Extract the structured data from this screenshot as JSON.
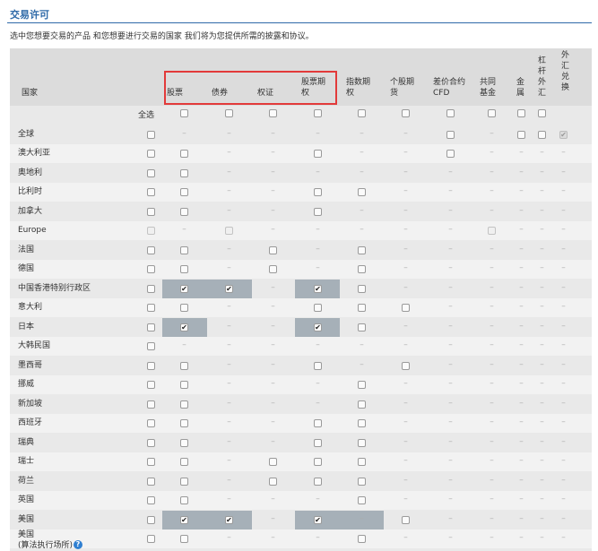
{
  "title": "交易许可",
  "description": "选中您想要交易的产品 和您想要进行交易的国家 我们将为您提供所需的披露和协议。",
  "header": {
    "country": "国家",
    "stocks": "股票",
    "bonds": "债券",
    "warrants": "权证",
    "stock_options": [
      "股票期",
      "权"
    ],
    "index_options": [
      "指数期",
      "权"
    ],
    "stock_futures": [
      "个股期",
      "货"
    ],
    "cfd": [
      "差价合约",
      "CFD"
    ],
    "mutual_funds": [
      "共同",
      "基金"
    ],
    "metals": [
      "金",
      "属"
    ],
    "leveraged_fx": "杠杆外汇",
    "fx_conversion": "外汇兑换"
  },
  "select_all_label": "全选",
  "rows": [
    {
      "country": "全球",
      "cells": [
        "cb",
        "-",
        "-",
        "-",
        "-",
        "-",
        "-",
        "cb",
        "-",
        "cb",
        "cb",
        "chk-dis"
      ]
    },
    {
      "country": "澳大利亚",
      "cells": [
        "cb",
        "cb",
        "-",
        "-",
        "cb",
        "-",
        "-",
        "cb",
        "-",
        "-",
        "-",
        "-"
      ]
    },
    {
      "country": "奥地利",
      "cells": [
        "cb",
        "cb",
        "-",
        "-",
        "-",
        "-",
        "-",
        "-",
        "-",
        "-",
        "-",
        "-"
      ]
    },
    {
      "country": "比利时",
      "cells": [
        "cb",
        "cb",
        "-",
        "-",
        "cb",
        "cb",
        "-",
        "-",
        "-",
        "-",
        "-",
        "-"
      ]
    },
    {
      "country": "加拿大",
      "cells": [
        "cb",
        "cb",
        "-",
        "-",
        "cb",
        "-",
        "-",
        "-",
        "-",
        "-",
        "-",
        "-"
      ]
    },
    {
      "country": "Europe",
      "cells": [
        "dis",
        "-",
        "dis",
        "-",
        "-",
        "-",
        "-",
        "-",
        "dis",
        "-",
        "-",
        "-"
      ]
    },
    {
      "country": "法国",
      "cells": [
        "cb",
        "cb",
        "-",
        "cb",
        "-",
        "cb",
        "-",
        "-",
        "-",
        "-",
        "-",
        "-"
      ]
    },
    {
      "country": "德国",
      "cells": [
        "cb",
        "cb",
        "-",
        "cb",
        "-",
        "cb",
        "-",
        "-",
        "-",
        "-",
        "-",
        "-"
      ]
    },
    {
      "country": "中国香港特别行政区",
      "cells": [
        "cb",
        "chk",
        "chk",
        "-",
        "chk",
        "cb",
        "-",
        "-",
        "-",
        "-",
        "-",
        "-"
      ]
    },
    {
      "country": "意大利",
      "cells": [
        "cb",
        "cb",
        "-",
        "-",
        "cb",
        "cb",
        "cb",
        "-",
        "-",
        "-",
        "-",
        "-"
      ]
    },
    {
      "country": "日本",
      "cells": [
        "cb",
        "chk",
        "-",
        "-",
        "chk",
        "cb",
        "-",
        "-",
        "-",
        "-",
        "-",
        "-"
      ]
    },
    {
      "country": "大韩民国",
      "cells": [
        "cb",
        "-",
        "-",
        "-",
        "-",
        "-",
        "-",
        "-",
        "-",
        "-",
        "-",
        "-"
      ]
    },
    {
      "country": "墨西哥",
      "cells": [
        "cb",
        "cb",
        "-",
        "-",
        "cb",
        "-",
        "cb",
        "-",
        "-",
        "-",
        "-",
        "-"
      ]
    },
    {
      "country": "挪威",
      "cells": [
        "cb",
        "cb",
        "-",
        "-",
        "-",
        "cb",
        "-",
        "-",
        "-",
        "-",
        "-",
        "-"
      ]
    },
    {
      "country": "新加坡",
      "cells": [
        "cb",
        "cb",
        "-",
        "-",
        "-",
        "cb",
        "-",
        "-",
        "-",
        "-",
        "-",
        "-"
      ]
    },
    {
      "country": "西班牙",
      "cells": [
        "cb",
        "cb",
        "-",
        "-",
        "cb",
        "cb",
        "-",
        "-",
        "-",
        "-",
        "-",
        "-"
      ]
    },
    {
      "country": "瑞典",
      "cells": [
        "cb",
        "cb",
        "-",
        "-",
        "cb",
        "cb",
        "-",
        "-",
        "-",
        "-",
        "-",
        "-"
      ]
    },
    {
      "country": "瑞士",
      "cells": [
        "cb",
        "cb",
        "-",
        "cb",
        "cb",
        "cb",
        "-",
        "-",
        "-",
        "-",
        "-",
        "-"
      ]
    },
    {
      "country": "荷兰",
      "cells": [
        "cb",
        "cb",
        "-",
        "cb",
        "cb",
        "cb",
        "-",
        "-",
        "-",
        "-",
        "-",
        "-"
      ]
    },
    {
      "country": "英国",
      "cells": [
        "cb",
        "cb",
        "-",
        "-",
        "-",
        "cb",
        "-",
        "-",
        "-",
        "-",
        "-",
        "-"
      ]
    },
    {
      "country": "美国",
      "cells": [
        "cb",
        "chk",
        "chk",
        "-",
        "chk",
        "-",
        "cb",
        "-",
        "-",
        "-",
        "-",
        "-"
      ]
    },
    {
      "country": [
        "美国",
        "(算法执行场所)"
      ],
      "cells": [
        "cb",
        "cb",
        "-",
        "-",
        "-",
        "cb",
        "-",
        "-",
        "-",
        "-",
        "-",
        "-"
      ]
    }
  ],
  "select_all_cells": [
    "cb",
    "cb",
    "cb",
    "cb",
    "cb",
    "cb",
    "cb",
    "cb",
    "cb",
    "cb"
  ],
  "highlight_rows": {
    "中国香港特别行政区": [
      [
        1,
        2
      ],
      [
        4,
        4
      ]
    ],
    "日本": [
      [
        1,
        1
      ],
      [
        4,
        4
      ]
    ],
    "美国": [
      [
        1,
        2
      ],
      [
        4,
        5
      ]
    ]
  },
  "icons": {
    "checkmark": "✔",
    "help": "help-circle-icon"
  }
}
